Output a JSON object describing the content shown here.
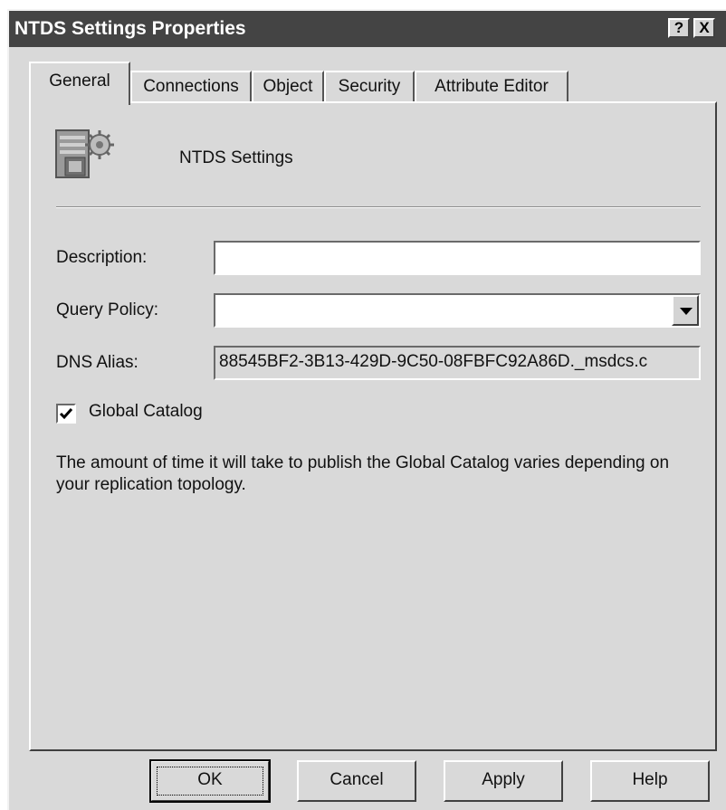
{
  "window": {
    "title": "NTDS Settings Properties",
    "help_glyph": "?",
    "close_glyph": "X"
  },
  "tabs": [
    {
      "label": "General",
      "active": true
    },
    {
      "label": "Connections",
      "active": false
    },
    {
      "label": "Object",
      "active": false
    },
    {
      "label": "Security",
      "active": false
    },
    {
      "label": "Attribute Editor",
      "active": false
    }
  ],
  "general": {
    "icon": "ntds-settings-icon",
    "object_name": "NTDS Settings",
    "description_label": "Description:",
    "description_value": "",
    "query_policy_label": "Query Policy:",
    "query_policy_value": "",
    "dns_alias_label": "DNS Alias:",
    "dns_alias_value": "88545BF2-3B13-429D-9C50-08FBFC92A86D._msdcs.c",
    "global_catalog_label": "Global Catalog",
    "global_catalog_checked": true,
    "info_text": "The amount of time it will take to publish the Global Catalog varies depending on your replication topology."
  },
  "buttons": {
    "ok": "OK",
    "cancel": "Cancel",
    "apply": "Apply",
    "help": "Help"
  },
  "colors": {
    "titlebar": "#444444",
    "dialog_bg": "#d9d9d9"
  }
}
